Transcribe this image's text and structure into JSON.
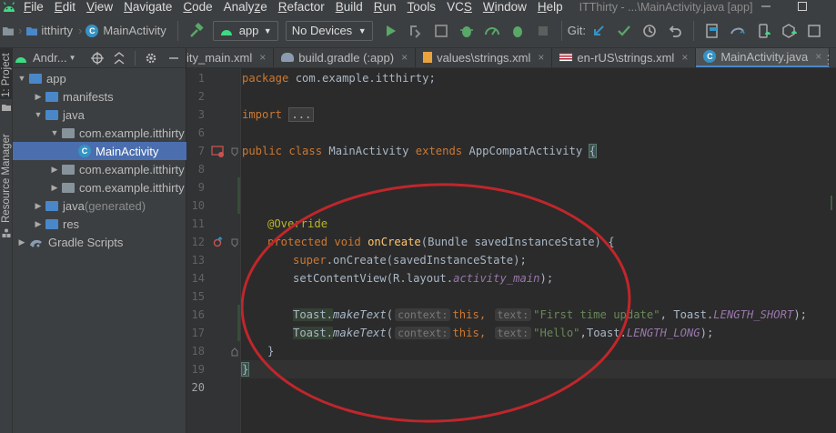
{
  "menu": {
    "items": [
      "File",
      "Edit",
      "View",
      "Navigate",
      "Code",
      "Analyze",
      "Refactor",
      "Build",
      "Run",
      "Tools",
      "VCS",
      "Window",
      "Help"
    ],
    "underline_first": [
      "F",
      "E",
      "V",
      "N",
      "C",
      "z",
      "R",
      "B",
      "R",
      "T",
      "S",
      "W",
      "H"
    ],
    "window_title": "ITThirty - ...\\MainActivity.java [app]"
  },
  "toolbar": {
    "breadcrumb_project": "itthirty",
    "breadcrumb_file": "MainActivity",
    "run_config": "app",
    "device": "No Devices",
    "git_label": "Git:"
  },
  "left_strip": {
    "project_tab": "1: Project",
    "resource_manager_tab": "Resource Manager"
  },
  "project_panel": {
    "header": "Andr...",
    "tree": [
      {
        "label": "app",
        "suffix": "",
        "arrow": "▼",
        "icon": "folder-blue",
        "indent": 0,
        "selected": false
      },
      {
        "label": "manifests",
        "suffix": "",
        "arrow": "▶",
        "icon": "folder-blue",
        "indent": 1,
        "selected": false
      },
      {
        "label": "java",
        "suffix": "",
        "arrow": "▼",
        "icon": "folder-blue",
        "indent": 1,
        "selected": false
      },
      {
        "label": "com.example.itthirty",
        "suffix": "",
        "arrow": "▼",
        "icon": "package",
        "indent": 2,
        "selected": false
      },
      {
        "label": "MainActivity",
        "suffix": "",
        "arrow": "",
        "icon": "class",
        "indent": 3,
        "selected": true
      },
      {
        "label": "com.example.itthirty",
        "suffix": "",
        "arrow": "▶",
        "icon": "package",
        "indent": 2,
        "selected": false
      },
      {
        "label": "com.example.itthirty",
        "suffix": "",
        "arrow": "▶",
        "icon": "package",
        "indent": 2,
        "selected": false
      },
      {
        "label": "java",
        "suffix": " (generated)",
        "arrow": "▶",
        "icon": "folder-blue",
        "indent": 1,
        "selected": false
      },
      {
        "label": "res",
        "suffix": "",
        "arrow": "▶",
        "icon": "folder-blue",
        "indent": 1,
        "selected": false
      },
      {
        "label": "Gradle Scripts",
        "suffix": "",
        "arrow": "▶",
        "icon": "gradle",
        "indent": 0,
        "selected": false
      }
    ]
  },
  "tabs": [
    {
      "label": "ity_main.xml",
      "icon": "xml-icon",
      "active": false
    },
    {
      "label": "build.gradle (:app)",
      "icon": "gradle-icon",
      "active": false
    },
    {
      "label": "values\\strings.xml",
      "icon": "xml-icon",
      "active": false
    },
    {
      "label": "en-rUS\\strings.xml",
      "icon": "flag-icon",
      "active": false
    },
    {
      "label": "MainActivity.java",
      "icon": "class-icon",
      "active": true
    }
  ],
  "line_numbers": [
    "1",
    "2",
    "3",
    "6",
    "7",
    "8",
    "9",
    "10",
    "11",
    "12",
    "13",
    "14",
    "15",
    "16",
    "17",
    "18",
    "19",
    "20"
  ],
  "code": {
    "l1": [
      "package ",
      "com.example.itthirty;"
    ],
    "l3": [
      "import ",
      "..."
    ],
    "l8": [
      "public class ",
      "MainActivity ",
      "extends ",
      "AppCompatActivity ",
      "{"
    ],
    "l12": [
      "@Override"
    ],
    "l13": [
      "protected void ",
      "onCreate",
      "(Bundle savedInstanceState) {"
    ],
    "l14": [
      "super",
      ".onCreate(savedInstanceState);"
    ],
    "l15": [
      "setContentView(R.layout.",
      "activity_main",
      ");"
    ],
    "l17": [
      "Toast.",
      "makeText",
      "(",
      "context:",
      "this",
      ", ",
      "text:",
      "\"First time update\"",
      ", Toast.",
      "LENGTH_SHORT",
      ");"
    ],
    "l18": [
      "Toast.",
      "makeText",
      "(",
      "context:",
      "this",
      ", ",
      "text:",
      "\"Hello\"",
      ",Toast.",
      "LENGTH_LONG",
      ");"
    ],
    "l19": [
      "}"
    ],
    "l20": [
      "}"
    ]
  },
  "colors": {
    "keyword": "#cc7832",
    "string": "#6a8759",
    "annotation": "#bbb529",
    "field": "#9876aa",
    "method": "#ffc66d",
    "circle_annotation": "#c0262b",
    "selection": "#4b6eaf"
  }
}
